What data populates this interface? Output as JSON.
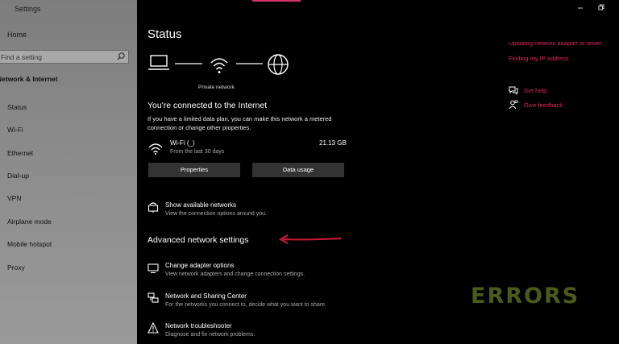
{
  "window": {
    "title": "Settings"
  },
  "sidebar": {
    "home": "Home",
    "search_placeholder": "Find a setting",
    "section": "Network & Internet",
    "items": [
      "Status",
      "Wi-Fi",
      "Ethernet",
      "Dial-up",
      "VPN",
      "Airplane mode",
      "Mobile hotspot",
      "Proxy"
    ]
  },
  "main": {
    "title": "Status",
    "diagram_label": "Private network",
    "connected_heading": "You're connected to the Internet",
    "connected_desc": "If you have a limited data plan, you can make this network a metered connection or change other properties.",
    "network": {
      "name": "Wi-Fi (_)",
      "period": "From the last 30 days",
      "usage": "21.13 GB"
    },
    "buttons": {
      "properties": "Properties",
      "data_usage": "Data usage"
    },
    "show_networks": {
      "title": "Show available networks",
      "desc": "View the connection options around you."
    },
    "advanced_heading": "Advanced network settings",
    "advanced_items": [
      {
        "title": "Change adapter options",
        "desc": "View network adapters and change connection settings."
      },
      {
        "title": "Network and Sharing Center",
        "desc": "For the networks you connect to, decide what you want to share."
      },
      {
        "title": "Network troubleshooter",
        "desc": "Diagnose and fix network problems."
      }
    ]
  },
  "right_panel": {
    "updating_link": "Updating network adapter or driver",
    "ip_link": "Finding my IP address",
    "help": "Get help",
    "feedback": "Give feedback"
  },
  "watermark": "ERRORS",
  "colors": {
    "accent": "#e0245e",
    "arrow": "#c0182e",
    "sidebar": "#8a8a8a",
    "background": "#000000"
  }
}
